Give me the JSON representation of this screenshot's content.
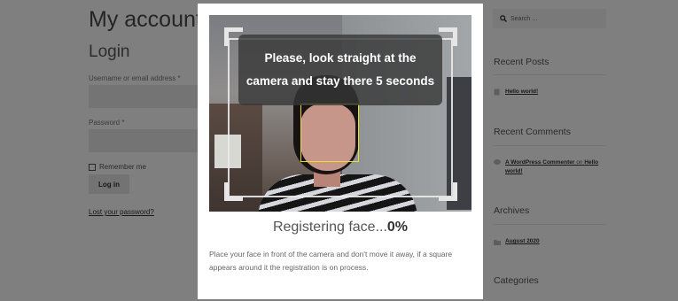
{
  "account": {
    "title": "My account",
    "login_heading": "Login",
    "username_label": "Username or email address *",
    "password_label": "Password *",
    "remember_label": "Remember me",
    "login_button": "Log in",
    "lost_password": "Lost your password?"
  },
  "sidebar": {
    "search_placeholder": "Search …",
    "recent_posts_title": "Recent Posts",
    "recent_posts": [
      "Hello world!"
    ],
    "recent_comments_title": "Recent Comments",
    "comment": {
      "author": "A WordPress Commenter",
      "on": " on ",
      "post": "Hello world!"
    },
    "archives_title": "Archives",
    "archives": [
      "August 2020"
    ],
    "categories_title": "Categories"
  },
  "modal": {
    "instruction": "Please, look straight at the camera and stay there 5 seconds",
    "status_prefix": "Registering face...",
    "status_percent": "0%",
    "description": "Place your face in front of the camera and don't move it away, if a square appears around it the registration is on process."
  },
  "icons": {
    "search": "search-icon",
    "post": "document-icon",
    "comment": "comment-icon",
    "folder": "folder-icon"
  },
  "colors": {
    "overlay": "#000000",
    "face_box": "#f0dc2a"
  }
}
